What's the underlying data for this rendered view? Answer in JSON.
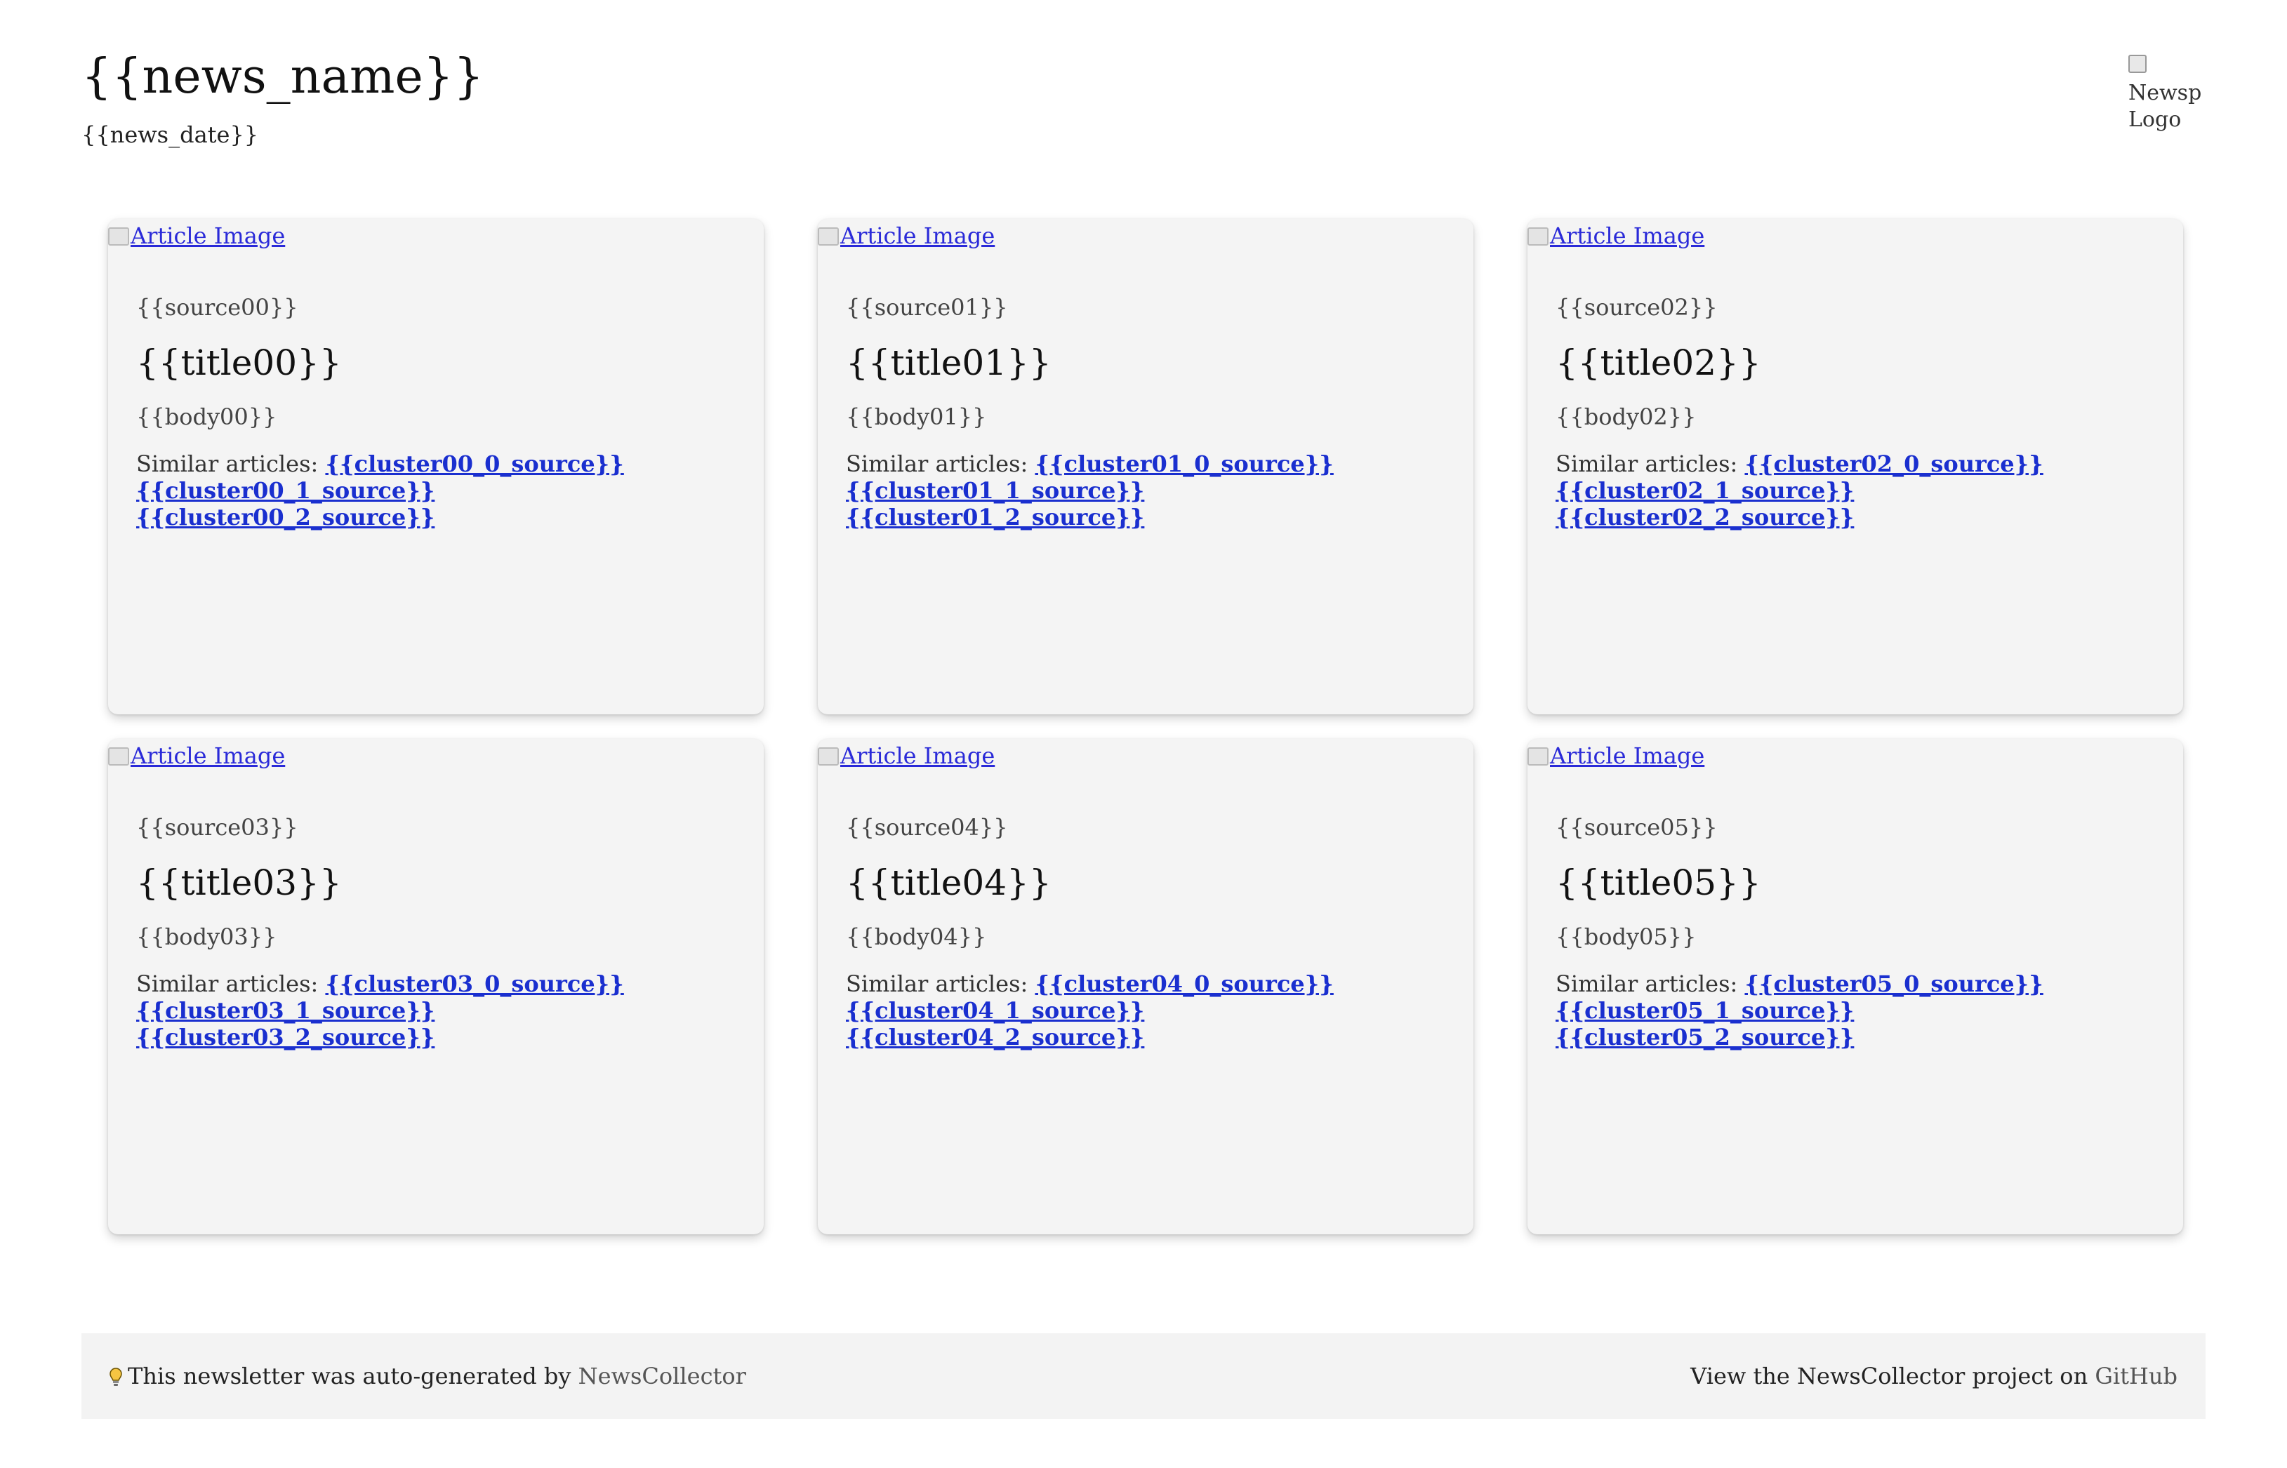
{
  "header": {
    "news_name": "{{news_name}}",
    "news_date": "{{news_date}}",
    "logo_alt": "Newsp\nLogo"
  },
  "cards": [
    {
      "image_alt": "Article Image",
      "source": "{{source00}}",
      "title": "{{title00}}",
      "body": "{{body00}}",
      "similar_label": "Similar articles: ",
      "cluster": [
        "{{cluster00_0_source}}",
        "{{cluster00_1_source}}",
        "{{cluster00_2_source}}"
      ]
    },
    {
      "image_alt": "Article Image",
      "source": "{{source01}}",
      "title": "{{title01}}",
      "body": "{{body01}}",
      "similar_label": "Similar articles: ",
      "cluster": [
        "{{cluster01_0_source}}",
        "{{cluster01_1_source}}",
        "{{cluster01_2_source}}"
      ]
    },
    {
      "image_alt": "Article Image",
      "source": "{{source02}}",
      "title": "{{title02}}",
      "body": "{{body02}}",
      "similar_label": "Similar articles: ",
      "cluster": [
        "{{cluster02_0_source}}",
        "{{cluster02_1_source}}",
        "{{cluster02_2_source}}"
      ]
    },
    {
      "image_alt": "Article Image",
      "source": "{{source03}}",
      "title": "{{title03}}",
      "body": "{{body03}}",
      "similar_label": "Similar articles: ",
      "cluster": [
        "{{cluster03_0_source}}",
        "{{cluster03_1_source}}",
        "{{cluster03_2_source}}"
      ]
    },
    {
      "image_alt": "Article Image",
      "source": "{{source04}}",
      "title": "{{title04}}",
      "body": "{{body04}}",
      "similar_label": "Similar articles: ",
      "cluster": [
        "{{cluster04_0_source}}",
        "{{cluster04_1_source}}",
        "{{cluster04_2_source}}"
      ]
    },
    {
      "image_alt": "Article Image",
      "source": "{{source05}}",
      "title": "{{title05}}",
      "body": "{{body05}}",
      "similar_label": "Similar articles: ",
      "cluster": [
        "{{cluster05_0_source}}",
        "{{cluster05_1_source}}",
        "{{cluster05_2_source}}"
      ]
    }
  ],
  "footer": {
    "left_text": "This newsletter was auto-generated by ",
    "left_link": "NewsCollector",
    "right_text": "View the NewsCollector project on ",
    "right_link": "GitHub",
    "icon": "lightbulb-icon"
  },
  "colors": {
    "link": "#1a2fcf",
    "card_bg": "#f4f4f4",
    "footer_bg": "#f3f3f3"
  }
}
